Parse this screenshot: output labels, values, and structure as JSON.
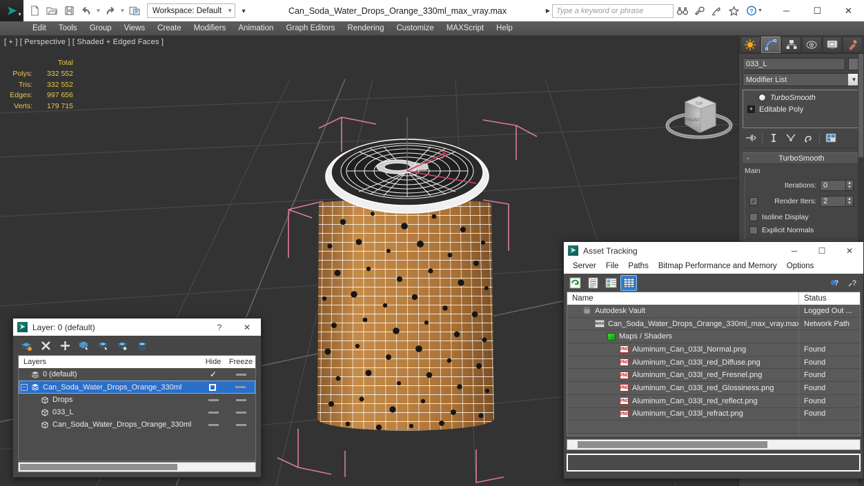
{
  "titlebar": {
    "app_icon": "3dsmax-logo",
    "workspace": "Workspace: Default",
    "document_title": "Can_Soda_Water_Drops_Orange_330ml_max_vray.max",
    "search_placeholder": "Type a keyword or phrase",
    "quick_access": [
      {
        "name": "new-file-icon",
        "label": "New"
      },
      {
        "name": "open-file-icon",
        "label": "Open"
      },
      {
        "name": "save-file-icon",
        "label": "Save"
      },
      {
        "name": "undo-icon",
        "label": "Undo"
      },
      {
        "name": "redo-icon",
        "label": "Redo"
      },
      {
        "name": "project-folder-icon",
        "label": "Set Project Folder"
      }
    ],
    "help_icons": [
      {
        "name": "search-binoculars-icon",
        "label": "Search"
      },
      {
        "name": "wrench-icon",
        "label": "Tools"
      },
      {
        "name": "satellite-icon",
        "label": "Communication Center"
      },
      {
        "name": "star-icon",
        "label": "Favorites"
      },
      {
        "name": "help-icon",
        "label": "Help"
      }
    ],
    "window_buttons": {
      "minimize": "─",
      "maximize": "☐",
      "close": "✕"
    }
  },
  "menubar": {
    "items": [
      "Edit",
      "Tools",
      "Group",
      "Views",
      "Create",
      "Modifiers",
      "Animation",
      "Graph Editors",
      "Rendering",
      "Customize",
      "MAXScript",
      "Help"
    ]
  },
  "viewport": {
    "label": "[ + ] [ Perspective ] [ Shaded + Edged Faces ]",
    "stats": {
      "header": "Total",
      "rows": [
        {
          "label": "Polys:",
          "value": "332 552"
        },
        {
          "label": "Tris:",
          "value": "332 552"
        },
        {
          "label": "Edges:",
          "value": "997 656"
        },
        {
          "label": "Verts:",
          "value": "179 715"
        }
      ]
    },
    "viewcube": {
      "name": "view-cube",
      "front_face": "FRONT",
      "top_face": "TOP"
    },
    "colors": {
      "background": "#333333",
      "grid": "#4a4a4a",
      "selection_bracket": "#e07a9a",
      "can_body": "#c08443",
      "can_top": "#f0f0f0",
      "wireframe": "#ffffff",
      "stats_text": "#e8c84a"
    }
  },
  "command_panel": {
    "tabs": [
      {
        "name": "create-tab",
        "label": "Create",
        "active": false
      },
      {
        "name": "modify-tab",
        "label": "Modify",
        "active": true
      },
      {
        "name": "hierarchy-tab",
        "label": "Hierarchy",
        "active": false
      },
      {
        "name": "motion-tab",
        "label": "Motion",
        "active": false
      },
      {
        "name": "display-tab",
        "label": "Display",
        "active": false
      },
      {
        "name": "utilities-tab",
        "label": "Utilities",
        "active": false
      }
    ],
    "object_name": "033_L",
    "modifier_list_label": "Modifier List",
    "modifier_stack": [
      {
        "name": "TurboSmooth",
        "italic": true,
        "icon": "bulb-icon"
      },
      {
        "name": "Editable Poly",
        "italic": false,
        "icon": "plus-icon"
      }
    ],
    "stack_tools": [
      {
        "name": "pin-stack-icon"
      },
      {
        "name": "show-end-result-icon"
      },
      {
        "name": "make-unique-icon"
      },
      {
        "name": "remove-modifier-icon"
      },
      {
        "name": "configure-modifier-sets-icon"
      }
    ],
    "rollout": {
      "title": "TurboSmooth",
      "collapse_glyph": "-",
      "group_label": "Main",
      "iterations_label": "Iterations:",
      "iterations_value": "0",
      "render_iters_label": "Render Iters:",
      "render_iters_value": "2",
      "render_iters_checked": true,
      "checkboxes": [
        {
          "label": "Isoline Display",
          "checked": false
        },
        {
          "label": "Explicit Normals",
          "checked": false
        }
      ]
    }
  },
  "layer_dialog": {
    "title": "Layer: 0 (default)",
    "help_glyph": "?",
    "close_glyph": "✕",
    "toolbar": [
      {
        "name": "new-layer-icon"
      },
      {
        "name": "delete-layer-icon"
      },
      {
        "name": "add-layer-icon"
      },
      {
        "name": "select-objects-in-layer-icon"
      },
      {
        "name": "highlight-selected-objects-icon"
      },
      {
        "name": "add-selection-to-layer-icon"
      },
      {
        "name": "set-current-layer-icon"
      }
    ],
    "columns": {
      "name": "Layers",
      "hide": "Hide",
      "freeze": "Freeze"
    },
    "rows": [
      {
        "name": "0 (default)",
        "indent": 0,
        "selected": false,
        "current_check": true,
        "expander": false,
        "icon": "layer-icon"
      },
      {
        "name": "Can_Soda_Water_Drops_Orange_330ml",
        "indent": 0,
        "selected": true,
        "current_check": false,
        "expander": true,
        "icon": "layer-icon"
      },
      {
        "name": "Drops",
        "indent": 1,
        "selected": false,
        "current_check": false,
        "expander": false,
        "icon": "object-icon"
      },
      {
        "name": "033_L",
        "indent": 1,
        "selected": false,
        "current_check": false,
        "expander": false,
        "icon": "object-icon"
      },
      {
        "name": "Can_Soda_Water_Drops_Orange_330ml",
        "indent": 1,
        "selected": false,
        "current_check": false,
        "expander": false,
        "icon": "object-icon"
      }
    ]
  },
  "asset_tracking": {
    "title": "Asset Tracking",
    "window_buttons": {
      "minimize": "─",
      "maximize": "☐",
      "close": "✕"
    },
    "menus": [
      "Server",
      "File",
      "Paths",
      "Bitmap Performance and Memory",
      "Options"
    ],
    "toolbar": [
      {
        "name": "refresh-icon",
        "active": false
      },
      {
        "name": "list-view-icon",
        "active": false
      },
      {
        "name": "detail-view-icon",
        "active": false
      },
      {
        "name": "table-view-icon",
        "active": true
      },
      {
        "name": "help-question-icon",
        "active": false
      },
      {
        "name": "context-help-icon",
        "active": false
      }
    ],
    "columns": {
      "name": "Name",
      "status": "Status"
    },
    "rows": [
      {
        "name": "Autodesk Vault",
        "status": "Logged Out ...",
        "indent": 0,
        "icon": "vault-icon"
      },
      {
        "name": "Can_Soda_Water_Drops_Orange_330ml_max_vray.max",
        "status": "Network Path",
        "indent": 1,
        "icon": "max-file-icon"
      },
      {
        "name": "Maps / Shaders",
        "status": "",
        "indent": 2,
        "icon": "maps-shaders-icon"
      },
      {
        "name": "Aluminum_Can_033l_Normal.png",
        "status": "Found",
        "indent": 3,
        "icon": "png-icon"
      },
      {
        "name": "Aluminum_Can_033l_red_Diffuse.png",
        "status": "Found",
        "indent": 3,
        "icon": "png-icon"
      },
      {
        "name": "Aluminum_Can_033l_red_Fresnel.png",
        "status": "Found",
        "indent": 3,
        "icon": "png-icon"
      },
      {
        "name": "Aluminum_Can_033l_red_Glossiness.png",
        "status": "Found",
        "indent": 3,
        "icon": "png-icon"
      },
      {
        "name": "Aluminum_Can_033l_red_reflect.png",
        "status": "Found",
        "indent": 3,
        "icon": "png-icon"
      },
      {
        "name": "Aluminum_Can_033l_refract.png",
        "status": "Found",
        "indent": 3,
        "icon": "png-icon"
      }
    ]
  }
}
